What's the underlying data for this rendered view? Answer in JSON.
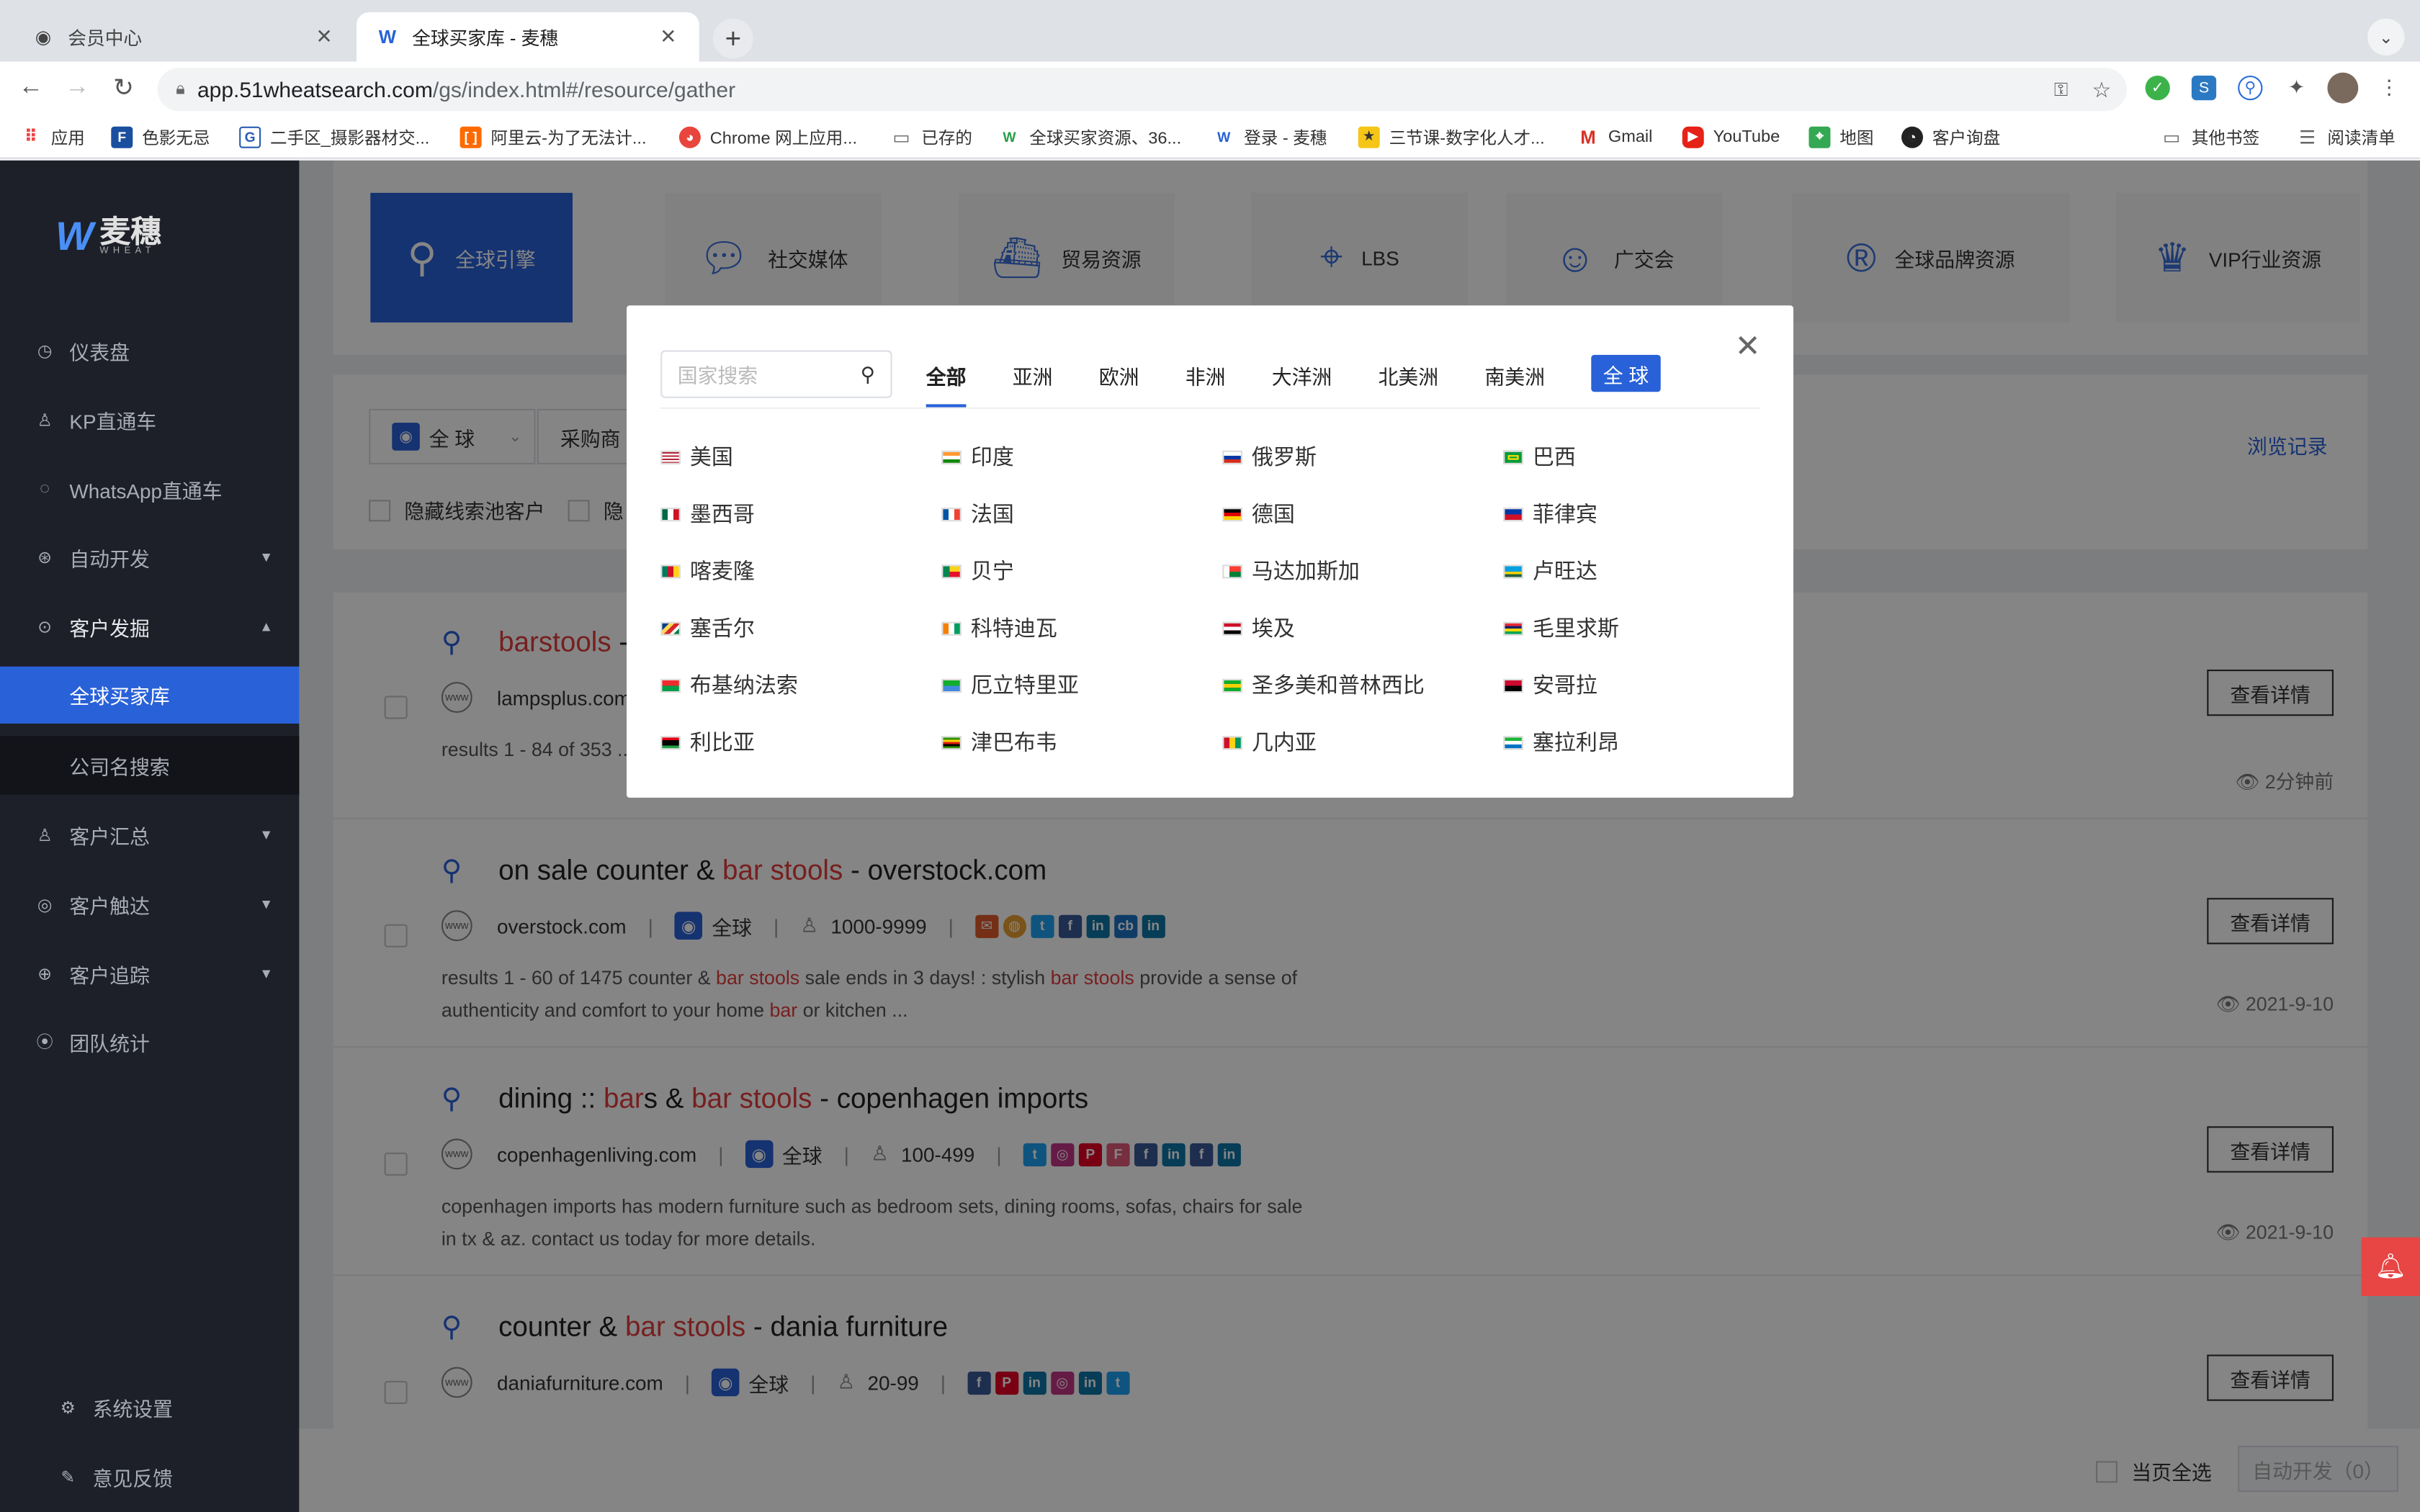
{
  "browser": {
    "tabs": [
      {
        "title": "会员中心"
      },
      {
        "title": "全球买家库 - 麦穗"
      }
    ],
    "url_host": "app.51wheatsearch.com",
    "url_path": "/gs/index.html#/resource/gather",
    "bookmarks": [
      "应用",
      "色影无忌",
      "二手区_摄影器材交...",
      "阿里云-为了无法计...",
      "Chrome 网上应用...",
      "已存的",
      "全球买家资源、36...",
      "登录 - 麦穗",
      "三节课-数字化人才...",
      "Gmail",
      "YouTube",
      "地图",
      "客户询盘",
      "其他书签",
      "阅读清单"
    ]
  },
  "sidebar": {
    "logo_cn": "麦穗",
    "logo_en": "WHEAT",
    "items": [
      "仪表盘",
      "KP直通车",
      "WhatsApp直通车",
      "自动开发",
      "客户发掘",
      "全球买家库",
      "公司名搜索",
      "客户汇总",
      "客户触达",
      "客户追踪",
      "团队统计"
    ],
    "bottom": [
      "系统设置",
      "意见反馈"
    ]
  },
  "resource_tabs": [
    "全球引擎",
    "社交媒体",
    "贸易资源",
    "LBS",
    "广交会",
    "全球品牌资源",
    "VIP行业资源"
  ],
  "filters": {
    "region": "全 球",
    "purchase": "采购商",
    "hide_pool": "隐藏线索池客户",
    "hide_more": "隐",
    "history": "浏览记录"
  },
  "results": [
    {
      "title_pre": "",
      "title_hl": "barstools",
      "title_post": " -",
      "domain": "lampsplus.com",
      "desc": "results 1 - 84 of 353 ... shipping on our items - adjustable, bar, or counter-height seating ...",
      "date": "2分钟前"
    },
    {
      "title_pre": "on sale counter & ",
      "title_hl": "bar stools",
      "title_post": " - overstock.com",
      "domain": "overstock.com",
      "region": "全球",
      "size": "1000-9999",
      "desc_parts": [
        "results 1 - 60 of 1475 counter & ",
        "bar stools",
        " sale ends in 3 days! : stylish ",
        "bar stools",
        " provide a sense of authenticity and comfort to your home ",
        "bar",
        " or kitchen ..."
      ],
      "date": "2021-9-10"
    },
    {
      "title_pre": "dining :: ",
      "title_hl": "bar",
      "title_mid": "s & ",
      "title_hl2": "bar stools",
      "title_post": " - copenhagen imports",
      "domain": "copenhagenliving.com",
      "region": "全球",
      "size": "100-499",
      "desc": "copenhagen imports has modern furniture such as bedroom sets, dining rooms, sofas, chairs for sale in tx & az. contact us today for more details.",
      "date": "2021-9-10"
    },
    {
      "title_pre": "counter & ",
      "title_hl": "bar stools",
      "title_post": " - dania furniture",
      "domain": "daniafurniture.com",
      "region": "全球",
      "size": "20-99"
    }
  ],
  "detail_label": "查看详情",
  "bottom": {
    "select_all": "当页全选",
    "auto_dev": "自动开发（0）"
  },
  "modal": {
    "search_placeholder": "国家搜索",
    "tabs": [
      "全部",
      "亚洲",
      "欧洲",
      "非洲",
      "大洋洲",
      "北美洲",
      "南美洲"
    ],
    "global_btn": "全 球",
    "countries": [
      "美国",
      "印度",
      "俄罗斯",
      "巴西",
      "墨西哥",
      "法国",
      "德国",
      "菲律宾",
      "喀麦隆",
      "贝宁",
      "马达加斯加",
      "卢旺达",
      "塞舌尔",
      "科特迪瓦",
      "埃及",
      "毛里求斯",
      "布基纳法索",
      "厄立特里亚",
      "圣多美和普林西比",
      "安哥拉",
      "利比亚",
      "津巴布韦",
      "几内亚",
      "塞拉利昂"
    ]
  },
  "colors": {
    "accent": "#2961d8",
    "sidebar": "#1d2028",
    "highlight": "#e23c3c"
  }
}
